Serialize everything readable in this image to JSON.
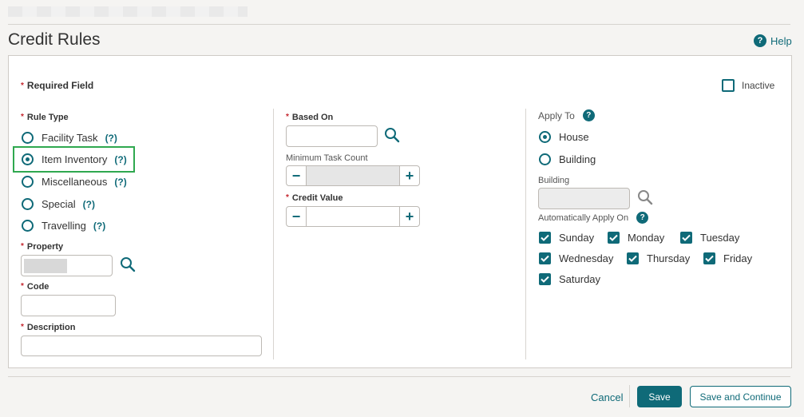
{
  "page": {
    "title": "Credit Rules",
    "help_label": "Help"
  },
  "form": {
    "required_note": "Required Field",
    "inactive_label": "Inactive",
    "inactive_checked": false,
    "rule_type": {
      "label": "Rule Type",
      "options": [
        {
          "label": "Facility Task",
          "hint": "(?)",
          "checked": false
        },
        {
          "label": "Item Inventory",
          "hint": "(?)",
          "checked": true
        },
        {
          "label": "Miscellaneous",
          "hint": "(?)",
          "checked": false
        },
        {
          "label": "Special",
          "hint": "(?)",
          "checked": false
        },
        {
          "label": "Travelling",
          "hint": "(?)",
          "checked": false
        }
      ]
    },
    "property": {
      "label": "Property",
      "value": ""
    },
    "code": {
      "label": "Code",
      "value": ""
    },
    "description": {
      "label": "Description",
      "value": ""
    },
    "based_on": {
      "label": "Based On",
      "value": ""
    },
    "minimum_task_count": {
      "label": "Minimum Task Count",
      "minus": "−",
      "plus": "+",
      "value": ""
    },
    "credit_value": {
      "label": "Credit Value",
      "minus": "−",
      "plus": "+",
      "value": ""
    },
    "apply_to": {
      "label": "Apply To",
      "info": "?",
      "options": [
        {
          "label": "House",
          "checked": true
        },
        {
          "label": "Building",
          "checked": false
        }
      ]
    },
    "building": {
      "label": "Building",
      "value": ""
    },
    "auto_apply": {
      "label": "Automatically Apply On",
      "info": "?",
      "days": [
        {
          "label": "Sunday",
          "checked": true
        },
        {
          "label": "Monday",
          "checked": true
        },
        {
          "label": "Tuesday",
          "checked": true
        },
        {
          "label": "Wednesday",
          "checked": true
        },
        {
          "label": "Thursday",
          "checked": true
        },
        {
          "label": "Friday",
          "checked": true
        },
        {
          "label": "Saturday",
          "checked": true
        }
      ]
    }
  },
  "footer": {
    "cancel": "Cancel",
    "save": "Save",
    "save_continue": "Save and Continue"
  },
  "colors": {
    "accent": "#0f6a78",
    "required": "#c4262e",
    "highlight": "#2fa84f"
  }
}
